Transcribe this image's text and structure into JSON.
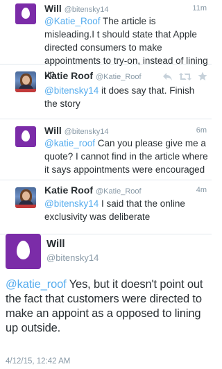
{
  "tweets": [
    {
      "name": "Will",
      "handle": "@bitensky14",
      "time": "11m",
      "mention": "@Katie_Roof",
      "text": " The article is misleading.I t should state that Apple directed consumers to make appointments to try-on, instead of lining up"
    },
    {
      "name": "Katie Roof",
      "handle": "@Katie_Roof",
      "time": "",
      "mention": "@bitensky14",
      "text": " it does say that. Finish the story"
    },
    {
      "name": "Will",
      "handle": "@bitensky14",
      "time": "6m",
      "mention": "@katie_roof",
      "text": " Can you please give me a quote? I cannot find in the article where it says appointments were encouraged"
    },
    {
      "name": "Katie Roof",
      "handle": "@Katie_Roof",
      "time": "4m",
      "mention": "@bitensky14",
      "text": " I said that the online exclusivity was deliberate"
    }
  ],
  "main_tweet": {
    "name": "Will",
    "handle": "@bitensky14",
    "mention": "@katie_roof",
    "text": " Yes, but it doesn't point out the fact that customers were directed to make an appoint as a opposed to lining up outside.",
    "timestamp": "4/12/15, 12:42 AM"
  },
  "icons": {
    "reply": "reply-icon",
    "retweet": "retweet-icon",
    "favorite": "star-icon"
  },
  "colors": {
    "mention": "#55acee",
    "egg_avatar": "#7b2ca8",
    "meta": "#8899a6"
  }
}
